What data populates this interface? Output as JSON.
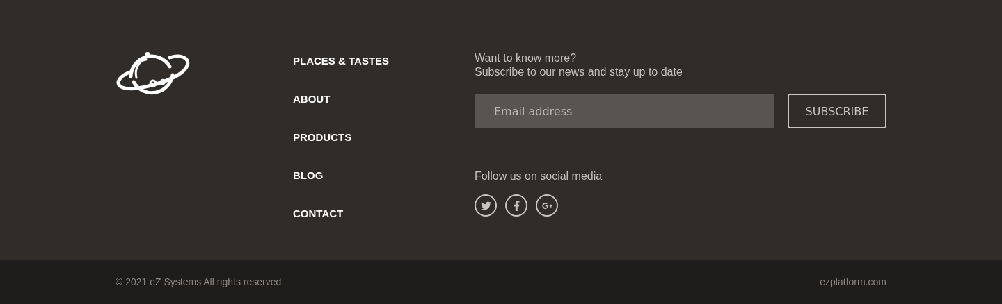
{
  "nav": {
    "items": [
      "PLACES & TASTES",
      "ABOUT",
      "PRODUCTS",
      "BLOG",
      "CONTACT"
    ]
  },
  "newsletter": {
    "heading": "Want to know more?",
    "text": "Subscribe to our news and stay up to date",
    "email": {
      "placeholder": "Email address"
    },
    "button": "SUBSCRIBE"
  },
  "social": {
    "heading": "Follow us on social media",
    "links": [
      {
        "kind": "twitter"
      },
      {
        "kind": "facebook"
      },
      {
        "kind": "googleplus"
      }
    ]
  },
  "bottom_bar": {
    "copyright": "© 2021 eZ Systems All rights reserved",
    "site": "ezplatform.com"
  }
}
